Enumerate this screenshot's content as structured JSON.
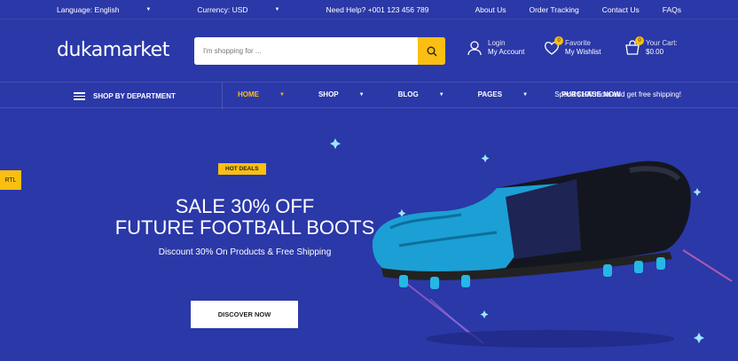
{
  "topbar": {
    "language": "Language: English",
    "currency": "Currency: USD",
    "help": "Need Help? +001 123 456 789",
    "links": [
      "About Us",
      "Order Tracking",
      "Contact Us",
      "FAQs"
    ]
  },
  "header": {
    "logo": "dukamarket",
    "search_placeholder": "I'm shopping for ...",
    "login_l1": "Login",
    "login_l2": "My Account",
    "wish_l1": "Favorite",
    "wish_l2": "My Wishlist",
    "wish_count": "0",
    "cart_l1": "Your Cart:",
    "cart_l2": "$0.00",
    "cart_count": "0"
  },
  "nav": {
    "department": "SHOP BY DEPARTMENT",
    "menu": [
      "HOME",
      "SHOP",
      "BLOG",
      "PAGES",
      "PURCHASE NOW"
    ],
    "promo": "Spend $120 more and get free shipping!"
  },
  "hero": {
    "rtl": "RTL",
    "badge": "HOT DEALS",
    "title1": "SALE 30% OFF",
    "title2": "FUTURE FOOTBALL BOOTS",
    "subtitle": "Discount 30% On Products & Free Shipping",
    "cta": "DISCOVER NOW"
  },
  "colors": {
    "background": "#2b38a8",
    "accent": "#fbbf12"
  },
  "icons": [
    "search-icon",
    "user-icon",
    "heart-icon",
    "cart-icon",
    "hamburger-icon",
    "chevron-down-icon"
  ]
}
